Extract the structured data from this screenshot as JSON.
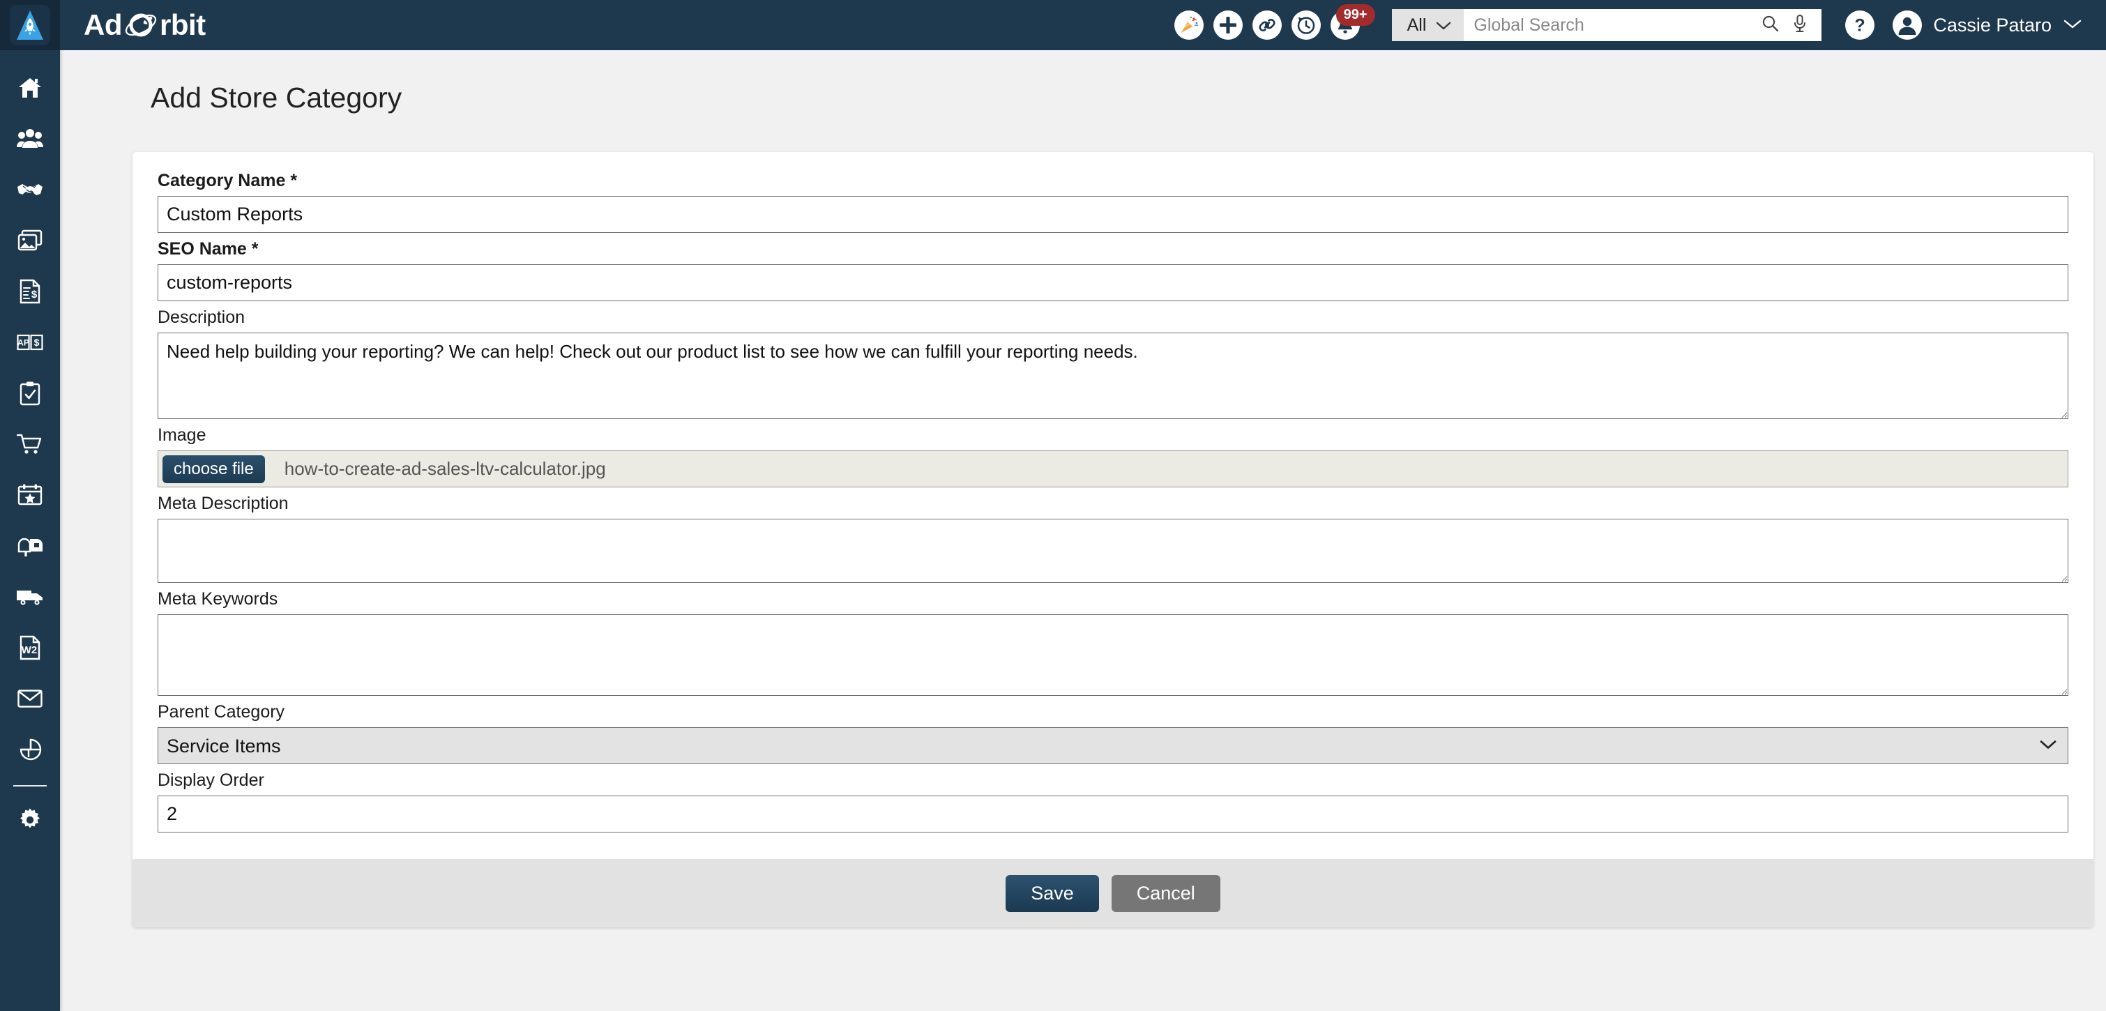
{
  "header": {
    "brand_prefix": "Ad",
    "brand_orbit_letter": "O",
    "brand_suffix": "rbit",
    "logo_icon": "rocket-logo-icon",
    "icons": [
      {
        "name": "celebration-icon",
        "label": "Celebration"
      },
      {
        "name": "add-icon",
        "label": "Add"
      },
      {
        "name": "link-icon",
        "label": "Quick Links"
      },
      {
        "name": "history-icon",
        "label": "Recent History"
      },
      {
        "name": "notifications-bell-icon",
        "label": "Notifications",
        "badge": "99+"
      }
    ],
    "search": {
      "scope_label": "All",
      "scope_chevron": "chevron-down-icon",
      "placeholder": "Global Search",
      "value": "",
      "search_icon": "search-icon",
      "mic_icon": "microphone-icon"
    },
    "help_icon": "help-question-icon",
    "user": {
      "avatar_icon": "user-avatar-icon",
      "name": "Cassie Pataro",
      "chevron": "chevron-down-icon"
    },
    "badge_color": "#a32b2b",
    "bar_color": "#1e384e"
  },
  "sidebar": {
    "items": [
      {
        "name": "sidebar-item-home",
        "icon": "home-icon",
        "label": "Home"
      },
      {
        "name": "sidebar-item-crm",
        "icon": "people-group-icon",
        "label": "CRM"
      },
      {
        "name": "sidebar-item-sales",
        "icon": "handshake-icon",
        "label": "Sales"
      },
      {
        "name": "sidebar-item-media",
        "icon": "images-icon",
        "label": "Media"
      },
      {
        "name": "sidebar-item-invoices",
        "icon": "invoice-dollar-icon",
        "label": "Invoices"
      },
      {
        "name": "sidebar-item-accounts-payable",
        "icon": "ap-ledger-dollar-icon",
        "label": "Accounts Payable"
      },
      {
        "name": "sidebar-item-tasks",
        "icon": "clipboard-check-icon",
        "label": "Tasks"
      },
      {
        "name": "sidebar-item-store",
        "icon": "shopping-cart-icon",
        "label": "Store"
      },
      {
        "name": "sidebar-item-events",
        "icon": "calendar-star-icon",
        "label": "Events"
      },
      {
        "name": "sidebar-item-subscriptions",
        "icon": "mailbox-icon",
        "label": "Subscriptions"
      },
      {
        "name": "sidebar-item-distribution",
        "icon": "delivery-truck-icon",
        "label": "Distribution"
      },
      {
        "name": "sidebar-item-w2",
        "icon": "w2-document-icon",
        "label": "W2"
      },
      {
        "name": "sidebar-item-email",
        "icon": "envelope-icon",
        "label": "Email"
      },
      {
        "name": "sidebar-item-reports",
        "icon": "pie-chart-icon",
        "label": "Reports"
      }
    ],
    "settings": {
      "name": "sidebar-item-settings",
      "icon": "gear-icon",
      "label": "Settings"
    },
    "bg_color": "#1e384e"
  },
  "page": {
    "title": "Add Store Category"
  },
  "form": {
    "category_name": {
      "label": "Category Name *",
      "value": "Custom Reports",
      "placeholder": "",
      "required": true
    },
    "seo_name": {
      "label": "SEO Name *",
      "value": "custom-reports",
      "placeholder": "",
      "required": true
    },
    "description": {
      "label": "Description",
      "value": "Need help building your reporting? We can help! Check out our product list to see how we can fulfill your reporting needs.",
      "placeholder": ""
    },
    "image": {
      "label": "Image",
      "button_label": "choose file",
      "file_name": "how-to-create-ad-sales-ltv-calculator.jpg"
    },
    "meta_description": {
      "label": "Meta Description",
      "value": "",
      "placeholder": ""
    },
    "meta_keywords": {
      "label": "Meta Keywords",
      "value": "",
      "placeholder": ""
    },
    "parent_category": {
      "label": "Parent Category",
      "selected": "Service Items",
      "options": [
        "Service Items"
      ]
    },
    "display_order": {
      "label": "Display Order",
      "value": "2",
      "placeholder": ""
    }
  },
  "footer": {
    "save_label": "Save",
    "cancel_label": "Cancel",
    "save_color": "#1b3951",
    "cancel_color": "#767676"
  }
}
